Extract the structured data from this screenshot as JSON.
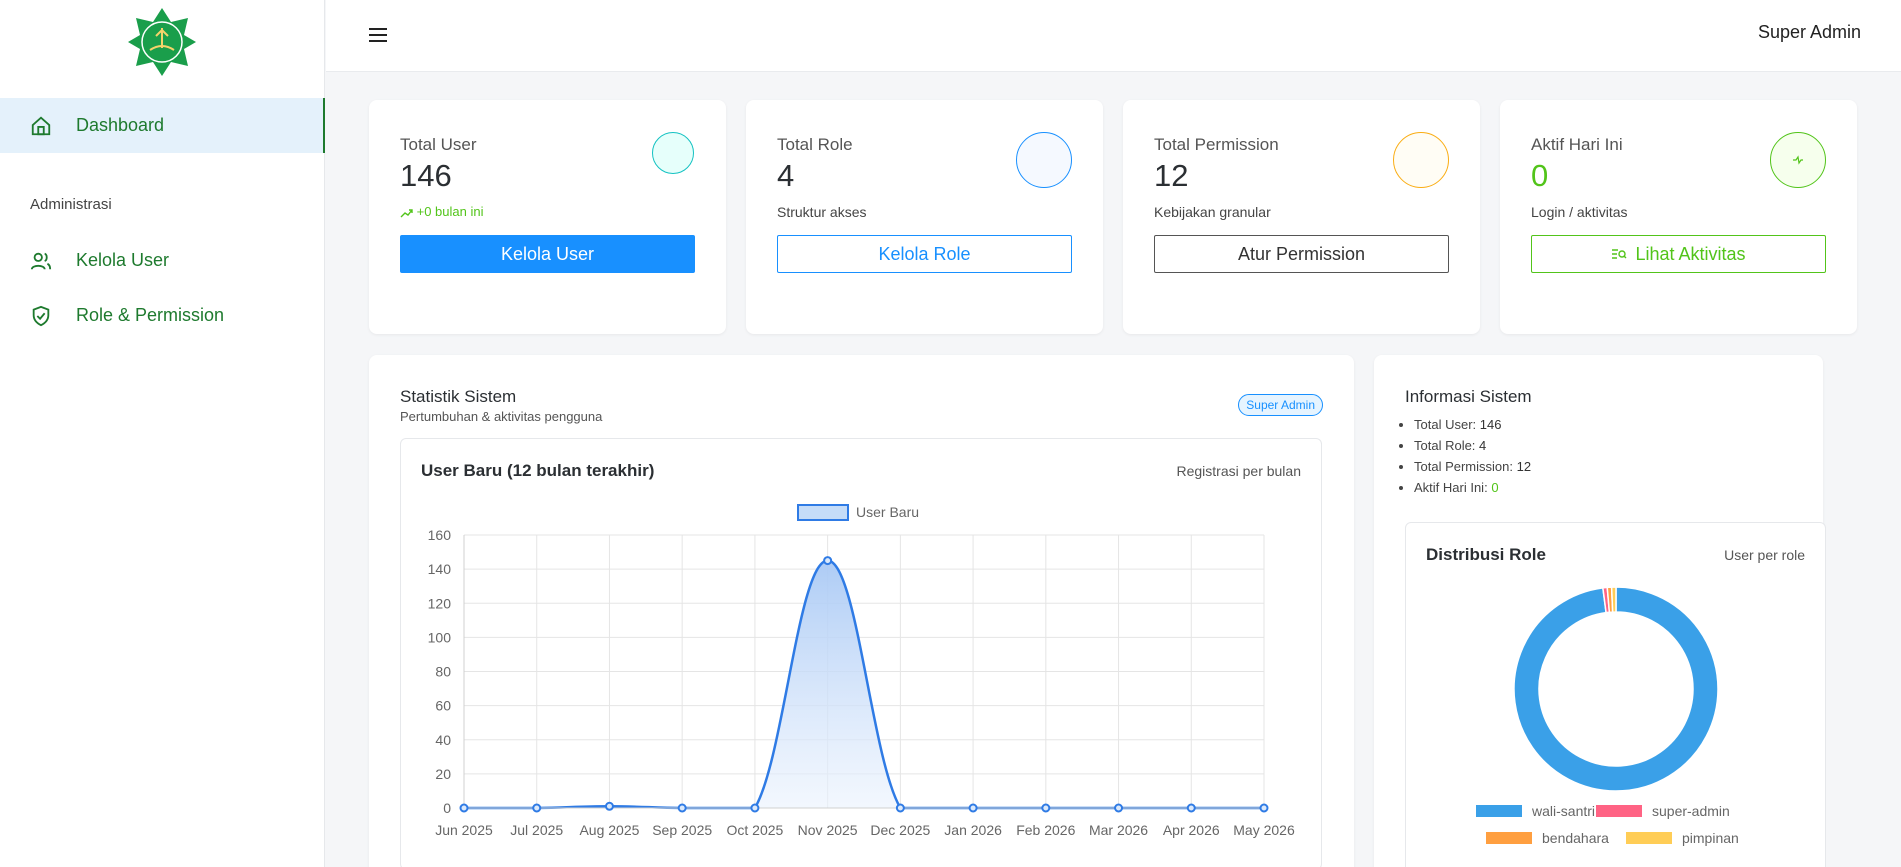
{
  "sidebar": {
    "nav": [
      {
        "label": "Dashboard",
        "icon": "home-icon",
        "active": true
      },
      {
        "label": "Kelola User",
        "icon": "users-icon",
        "active": false
      },
      {
        "label": "Role & Permission",
        "icon": "shield-icon",
        "active": false
      }
    ],
    "section_label": "Administrasi"
  },
  "header": {
    "user_name": "Super Admin"
  },
  "stats": [
    {
      "title": "Total User",
      "value": "146",
      "sub": "+0 bulan ini",
      "button": "Kelola User",
      "icon": "user-icon",
      "color": "#13c2c2"
    },
    {
      "title": "Total Role",
      "value": "4",
      "sub": "Struktur akses",
      "button": "Kelola Role",
      "icon": "team-icon",
      "color": "#1890ff"
    },
    {
      "title": "Total Permission",
      "value": "12",
      "sub": "Kebijakan granular",
      "button": "Atur Permission",
      "icon": "key-icon",
      "color": "#faad14"
    },
    {
      "title": "Aktif Hari Ini",
      "value": "0",
      "sub": "Login / aktivitas",
      "button": "Lihat Aktivitas",
      "icon": "activity-icon",
      "color": "#52c41a"
    }
  ],
  "statistik": {
    "title": "Statistik Sistem",
    "subtitle": "Pertumbuhan & aktivitas pengguna",
    "badge": "Super Admin"
  },
  "info": {
    "title": "Informasi Sistem",
    "items": [
      {
        "label": "Total User:",
        "value": "146"
      },
      {
        "label": "Total Role:",
        "value": "4"
      },
      {
        "label": "Total Permission:",
        "value": "12"
      },
      {
        "label": "Aktif Hari Ini:",
        "value": "0"
      }
    ]
  },
  "chart_data": [
    {
      "type": "area",
      "title": "User Baru (12 bulan terakhir)",
      "subtitle": "Registrasi per bulan",
      "categories": [
        "Jun 2025",
        "Jul 2025",
        "Aug 2025",
        "Sep 2025",
        "Oct 2025",
        "Nov 2025",
        "Dec 2025",
        "Jan 2026",
        "Feb 2026",
        "Mar 2026",
        "Apr 2026",
        "May 2026"
      ],
      "series": [
        {
          "name": "User Baru",
          "values": [
            0,
            0,
            1,
            0,
            0,
            145,
            0,
            0,
            0,
            0,
            0,
            0
          ]
        }
      ],
      "ylim": [
        0,
        160
      ],
      "yticks": [
        0,
        20,
        40,
        60,
        80,
        100,
        120,
        140,
        160
      ],
      "grid": true,
      "legend": "top",
      "color": "#2f7be5"
    },
    {
      "type": "pie",
      "title": "Distribusi Role",
      "subtitle": "User per role",
      "labels": [
        "wali-santri",
        "super-admin",
        "bendahara",
        "pimpinan"
      ],
      "values": [
        143,
        1,
        1,
        1
      ],
      "colors": [
        "#3aa0e8",
        "#ff6384",
        "#ff9f40",
        "#ffcd56"
      ],
      "legend": "bottom"
    }
  ]
}
